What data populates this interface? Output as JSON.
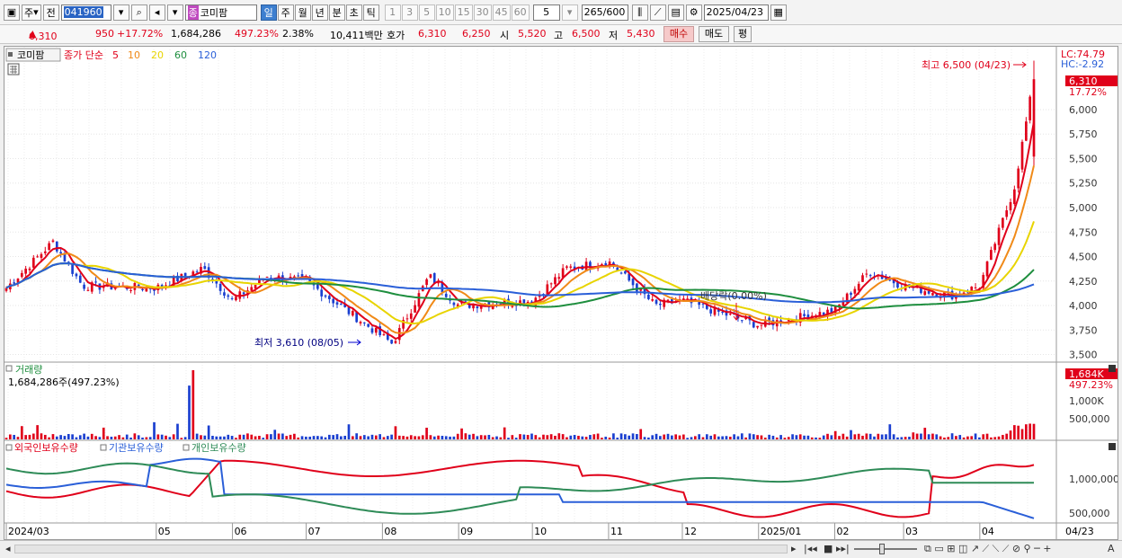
{
  "toolbar": {
    "market": "주",
    "prev": "전",
    "code": "041960",
    "name_badge": "종",
    "name": "코미팜",
    "periods": [
      "일",
      "주",
      "월",
      "년",
      "분",
      "초",
      "틱"
    ],
    "active_period": "일",
    "minute_steps": [
      "1",
      "3",
      "5",
      "10",
      "15",
      "30",
      "45",
      "60"
    ],
    "count_sel": "5",
    "bars_shown": "265",
    "bars_total": "/600",
    "date": "2025/04/23"
  },
  "quote": {
    "price": "6,310",
    "change": "950",
    "change_pct": "+17.72%",
    "volume": "1,684,286",
    "vol_ratio": "497.23%",
    "turnover": "2.38%",
    "amount": "10,411백만",
    "hoga_label": "호가",
    "ask": "6,310",
    "bid": "6,250",
    "open_label": "시",
    "open": "5,520",
    "high_label": "고",
    "high": "6,500",
    "low_label": "저",
    "low": "5,430",
    "buy_btn": "매수",
    "sell_btn": "매도",
    "eval_btn": "평"
  },
  "price_pane": {
    "stock_tab": "코미팜",
    "legend_prefix": "종가 단순",
    "ma_labels": [
      {
        "label": "5",
        "color": "#e0001a"
      },
      {
        "label": "10",
        "color": "#f08a18"
      },
      {
        "label": "20",
        "color": "#e8d400"
      },
      {
        "label": "60",
        "color": "#1e8e3e"
      },
      {
        "label": "120",
        "color": "#2a5fd8"
      }
    ],
    "lc": "LC:74.79",
    "hc": "HC:-2.92",
    "last_price_tag": "6,310",
    "last_pct_tag": "17.72%",
    "y_ticks": [
      "6,000",
      "5,750",
      "5,500",
      "5,250",
      "5,000",
      "4,750",
      "4,500",
      "4,250",
      "4,000",
      "3,750",
      "3,500"
    ],
    "high_note": "최고 6,500 (04/23)",
    "low_note": "최저 3,610 (08/05)",
    "dividend_note": "배당락(0.00%)"
  },
  "volume_pane": {
    "title": "거래량",
    "summary": "1,684,286주(497.23%)",
    "last_tag": "1,684K",
    "last_pct": "497.23%",
    "y_ticks": [
      "1,000K",
      "500,000"
    ]
  },
  "holding_pane": {
    "legend": [
      "외국인보유수량",
      "기관보유수량",
      "개인보유수량"
    ],
    "legend_colors": [
      "#e0001a",
      "#2a5fd8",
      "#2e8b57"
    ],
    "y_ticks": [
      "1,000,000",
      "500,000"
    ]
  },
  "x_axis": [
    "2024/03",
    "05",
    "06",
    "07",
    "08",
    "09",
    "10",
    "11",
    "12",
    "2025/01",
    "02",
    "03",
    "04"
  ],
  "x_axis_last": "04/23",
  "chart_data": {
    "type": "candlestick",
    "x_range": [
      "2024/03",
      "2025/04/23"
    ],
    "y_range": [
      3450,
      6550
    ],
    "close_path": [
      [
        "2024/03",
        4180
      ],
      [
        "2024/03/20",
        4650
      ],
      [
        "2024/04",
        4200
      ],
      [
        "2024/05",
        4180
      ],
      [
        "2024/05/20",
        4380
      ],
      [
        "2024/06",
        4050
      ],
      [
        "2024/06/15",
        4300
      ],
      [
        "2024/07",
        4250
      ],
      [
        "2024/08/05",
        3610
      ],
      [
        "2024/08/20",
        4300
      ],
      [
        "2024/09",
        4000
      ],
      [
        "2024/10",
        4050
      ],
      [
        "2024/10/15",
        4380
      ],
      [
        "2024/11",
        4450
      ],
      [
        "2024/11/20",
        4000
      ],
      [
        "2024/12",
        4050
      ],
      [
        "2024/12/26",
        3850
      ],
      [
        "2025/01",
        3800
      ],
      [
        "2025/02",
        3950
      ],
      [
        "2025/02/15",
        4350
      ],
      [
        "2025/03",
        4200
      ],
      [
        "2025/03/20",
        4100
      ],
      [
        "2025/04",
        4200
      ],
      [
        "2025/04/15",
        5200
      ],
      [
        "2025/04/23",
        6310
      ]
    ],
    "last": {
      "open": 5520,
      "high": 6500,
      "low": 5430,
      "close": 6310
    }
  }
}
